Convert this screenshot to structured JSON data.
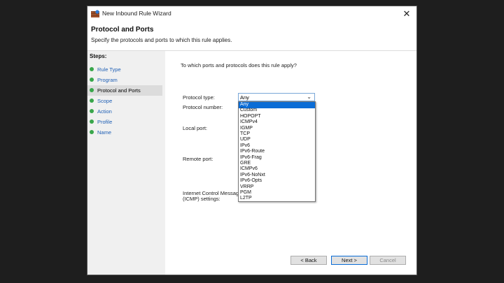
{
  "window": {
    "title": "New Inbound Rule Wizard",
    "close_glyph": "✕"
  },
  "header": {
    "title": "Protocol and Ports",
    "description": "Specify the protocols and ports to which this rule applies."
  },
  "steps": {
    "heading": "Steps:",
    "items": [
      {
        "label": "Rule Type",
        "current": false
      },
      {
        "label": "Program",
        "current": false
      },
      {
        "label": "Protocol and Ports",
        "current": true
      },
      {
        "label": "Scope",
        "current": false
      },
      {
        "label": "Action",
        "current": false
      },
      {
        "label": "Profile",
        "current": false
      },
      {
        "label": "Name",
        "current": false
      }
    ]
  },
  "content": {
    "question": "To which ports and protocols does this rule apply?",
    "protocol_type_label": "Protocol type:",
    "protocol_number_label": "Protocol number:",
    "local_port_label": "Local port:",
    "remote_port_label": "Remote port:",
    "icmp_label_line1": "Internet Control Message",
    "icmp_label_line2": "(ICMP) settings:",
    "protocol_select": {
      "value": "Any",
      "chevron_glyph": "⌄",
      "options": [
        "Any",
        "Custom",
        "HOPOPT",
        "ICMPv4",
        "IGMP",
        "TCP",
        "UDP",
        "IPv6",
        "IPv6-Route",
        "IPv6-Frag",
        "GRE",
        "ICMPv6",
        "IPv6-NoNxt",
        "IPv6-Opts",
        "VRRP",
        "PGM",
        "L2TP"
      ],
      "highlighted": "Any"
    }
  },
  "buttons": {
    "back": "< Back",
    "next": "Next >",
    "cancel": "Cancel"
  },
  "colors": {
    "accent": "#0a6cd6",
    "step_link": "#1f5fb5",
    "step_bullet": "#39a64b"
  }
}
